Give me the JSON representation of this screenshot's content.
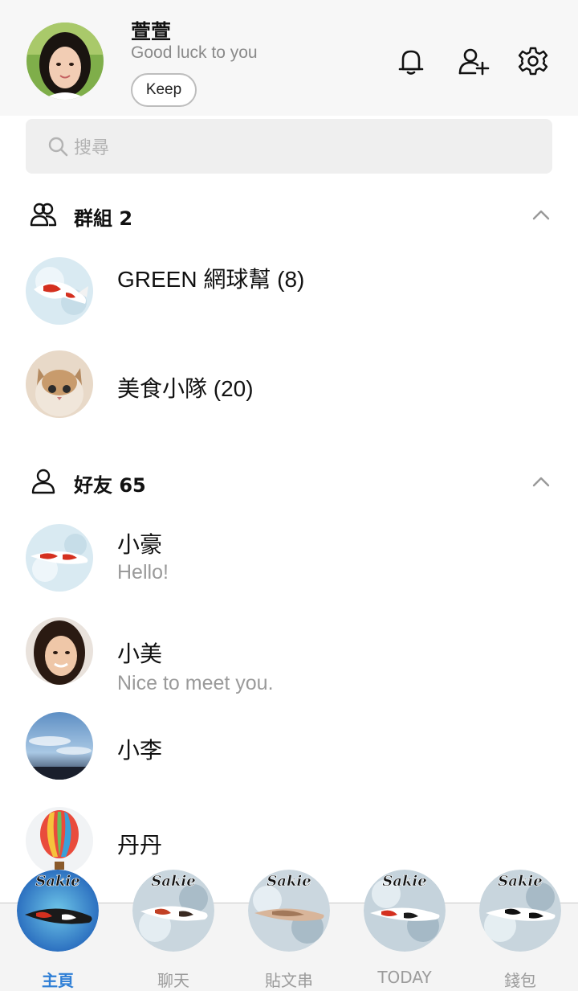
{
  "profile": {
    "name": "萱萱",
    "status": "Good luck to you",
    "keep_label": "Keep"
  },
  "header_icons": [
    "bell-icon",
    "add-friend-icon",
    "settings-gear-icon"
  ],
  "search": {
    "placeholder": "搜尋"
  },
  "groups": {
    "title": "群組 2",
    "items": [
      {
        "name": "GREEN 網球幫 (8)",
        "avatar": "koi-fish-avatar"
      },
      {
        "name": "美食小隊 (20)",
        "avatar": "cat-avatar"
      }
    ]
  },
  "friends": {
    "title": "好友 65",
    "items": [
      {
        "name": "小豪",
        "status": "Hello!",
        "avatar": "koi-fish-avatar"
      },
      {
        "name": "小美",
        "status": "Nice to meet you.",
        "avatar": "woman-avatar"
      },
      {
        "name": "小李",
        "status": "",
        "avatar": "sky-avatar"
      },
      {
        "name": "丹丹",
        "status": "",
        "avatar": "hot-air-balloon-avatar"
      }
    ]
  },
  "bottom_nav": {
    "items": [
      {
        "label": "主頁",
        "active": true,
        "badge_text": "Sakie"
      },
      {
        "label": "聊天",
        "active": false,
        "badge_text": "Sakie"
      },
      {
        "label": "貼文串",
        "active": false,
        "badge_text": "Sakie"
      },
      {
        "label": "TODAY",
        "active": false,
        "badge_text": "Sakie"
      },
      {
        "label": "錢包",
        "active": false,
        "badge_text": "Sakie"
      }
    ]
  },
  "colors": {
    "header_bg": "#f7f7f7",
    "active_tab": "#2f7fd6",
    "inactive_tab": "#9b9b9b",
    "search_bg": "#efefef"
  }
}
